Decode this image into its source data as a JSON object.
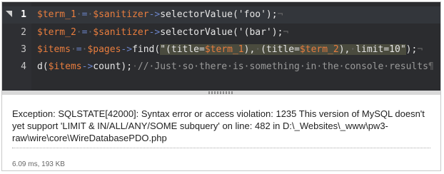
{
  "editor": {
    "line_numbers": [
      "1",
      "2",
      "3",
      "4"
    ],
    "lines": [
      {
        "segments": [
          {
            "t": "$term_1",
            "c": "v"
          },
          {
            "t": "·",
            "c": "inv"
          },
          {
            "t": "=",
            "c": "op"
          },
          {
            "t": "·",
            "c": "inv"
          },
          {
            "t": "$sanitizer",
            "c": "v"
          },
          {
            "t": "->",
            "c": "op"
          },
          {
            "t": "selectorValue('foo');",
            "c": "fn"
          },
          {
            "t": "¬",
            "c": "inv"
          }
        ]
      },
      {
        "segments": [
          {
            "t": "$term_2",
            "c": "v"
          },
          {
            "t": "·",
            "c": "inv"
          },
          {
            "t": "=",
            "c": "op"
          },
          {
            "t": "·",
            "c": "inv"
          },
          {
            "t": "$sanitizer",
            "c": "v"
          },
          {
            "t": "->",
            "c": "op"
          },
          {
            "t": "selectorValue('(bar');",
            "c": "fn"
          },
          {
            "t": "¬",
            "c": "inv"
          }
        ]
      },
      {
        "segments": [
          {
            "t": "$items",
            "c": "v"
          },
          {
            "t": "·",
            "c": "inv"
          },
          {
            "t": "=",
            "c": "op"
          },
          {
            "t": "·",
            "c": "inv"
          },
          {
            "t": "$pages",
            "c": "v"
          },
          {
            "t": "->",
            "c": "op"
          },
          {
            "t": "find(",
            "c": "fn"
          },
          {
            "t": "\"(title=",
            "c": "hl"
          },
          {
            "t": "$term_1",
            "c": "hlv"
          },
          {
            "t": "),",
            "c": "hl"
          },
          {
            "t": "·",
            "c": "hlinv"
          },
          {
            "t": "(title=",
            "c": "hl"
          },
          {
            "t": "$term_2",
            "c": "hlv"
          },
          {
            "t": "),",
            "c": "hl"
          },
          {
            "t": "·",
            "c": "hlinv"
          },
          {
            "t": "limit=10\"",
            "c": "hl"
          },
          {
            "t": ");",
            "c": "fn"
          },
          {
            "t": "¬",
            "c": "inv"
          }
        ]
      },
      {
        "segments": [
          {
            "t": "d(",
            "c": "fn"
          },
          {
            "t": "$items",
            "c": "v"
          },
          {
            "t": "->",
            "c": "op"
          },
          {
            "t": "count);",
            "c": "fn"
          },
          {
            "t": "·",
            "c": "inv"
          },
          {
            "t": "//·Just·so·there·is·something·in·the·console·results",
            "c": "cm"
          },
          {
            "t": "¶",
            "c": "inv"
          }
        ]
      }
    ]
  },
  "console": {
    "message": "Exception: SQLSTATE[42000]: Syntax error or access violation: 1235 This version of MySQL doesn't yet support 'LIMIT & IN/ALL/ANY/SOME subquery' on line: 482 in D:\\_Websites\\_www\\pw3-raw\\wire\\core\\WireDatabasePDO.php",
    "meta": "6.09 ms, 193 KB"
  }
}
